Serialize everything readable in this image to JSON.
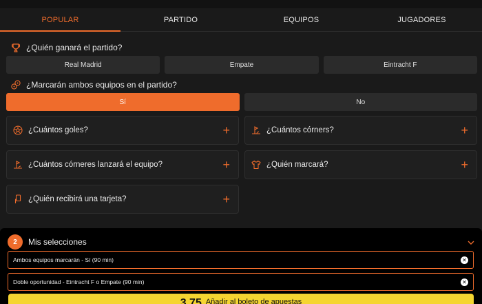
{
  "tabs": [
    {
      "label": "POPULAR",
      "active": true
    },
    {
      "label": "PARTIDO",
      "active": false
    },
    {
      "label": "EQUIPOS",
      "active": false
    },
    {
      "label": "JUGADORES",
      "active": false
    }
  ],
  "q1": {
    "icon": "trophy-icon",
    "text": "¿Quién ganará el partido?",
    "options": [
      "Real Madrid",
      "Empate",
      "Eintracht F"
    ]
  },
  "q2": {
    "icon": "balls-icon",
    "text": "¿Marcarán ambos equipos en el partido?",
    "options": [
      "Sí",
      "No"
    ],
    "selected": "Sí"
  },
  "cards": [
    {
      "icon": "football-icon",
      "label": "¿Cuántos goles?"
    },
    {
      "icon": "corner-flag-icon",
      "label": "¿Cuántos córners?"
    },
    {
      "icon": "corner-flag-icon",
      "label": "¿Cuántos córneres lanzará el equipo?"
    },
    {
      "icon": "jersey-icon",
      "label": "¿Quién marcará?"
    },
    {
      "icon": "card-icon",
      "label": "¿Quién recibirá una tarjeta?"
    }
  ],
  "plus_symbol": "+",
  "betslip": {
    "count": "2",
    "title": "Mis selecciones",
    "selections": [
      "Ambos equipos marcarán - Sí (90 min)",
      "Doble oportunidad - Eintracht F o Empate (90 min)"
    ],
    "odds": "3.75",
    "button_label": "Añadir al boleto de apuestas"
  },
  "colors": {
    "accent": "#ef6c2c",
    "background": "#1a1a1a",
    "bet_button": "#f5d531"
  }
}
